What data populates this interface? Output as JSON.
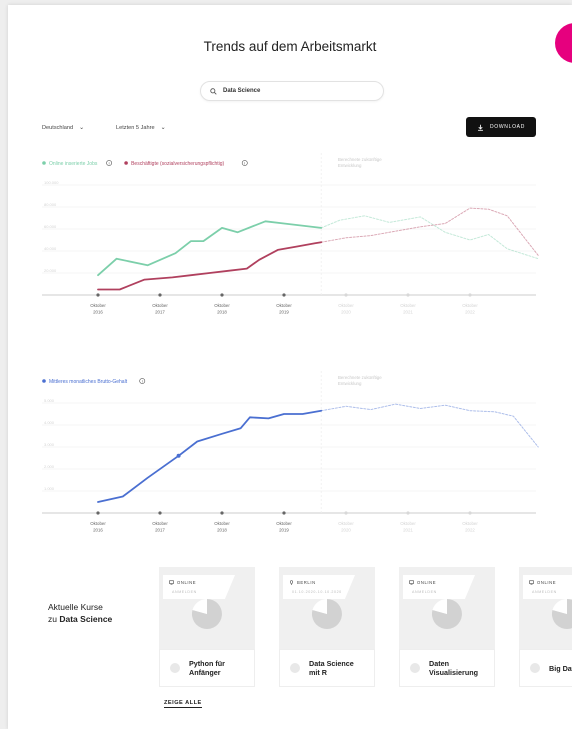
{
  "page": {
    "title": "Trends auf dem Arbeitsmarkt",
    "search_value": "Data Science",
    "region_dropdown": "Deutschland",
    "period_dropdown": "Letzten 5 Jahre",
    "download_label": "DOWNLOAD"
  },
  "colors": {
    "jobs": "#7ccfaa",
    "employed": "#b0405e",
    "salary": "#4a6fd1",
    "accent": "#e6007e"
  },
  "chart_data": [
    {
      "type": "line",
      "legend": [
        "Online inserierte Jobs",
        "Beschäftigte (sozialversicherungspflichtig)"
      ],
      "forecast_label": [
        "Berechnete zukünftige",
        "Entwicklung"
      ],
      "x_ticks": [
        [
          "Oktober",
          "2016"
        ],
        [
          "Oktober",
          "2017"
        ],
        [
          "Oktober",
          "2018"
        ],
        [
          "Oktober",
          "2019"
        ],
        [
          "Oktober",
          "2020"
        ],
        [
          "Oktober",
          "2021"
        ],
        [
          "Oktober",
          "2022"
        ]
      ],
      "y_ticks": [
        "20.000",
        "40.000",
        "60.000",
        "80.000",
        "100.000"
      ],
      "ylim": [
        0,
        100000
      ],
      "grid": true,
      "series": [
        {
          "name": "Online inserierte Jobs",
          "x": [
            0,
            0.3,
            0.8,
            1.25,
            1.5,
            1.7,
            2.0,
            2.25,
            2.7,
            3.0,
            3.6
          ],
          "y": [
            18000,
            33000,
            27000,
            38000,
            49000,
            49000,
            61000,
            57000,
            67000,
            65000,
            61000
          ]
        },
        {
          "name": "Online inserierte Jobs (Prognose)",
          "forecast": true,
          "x": [
            3.6,
            3.9,
            4.3,
            4.7,
            5.2,
            5.6,
            6.0,
            6.3,
            6.6,
            7.1
          ],
          "y": [
            61000,
            68000,
            72000,
            66000,
            71000,
            57000,
            50000,
            55000,
            42000,
            33000
          ]
        },
        {
          "name": "Beschäftigte (sozialversicherungspflichtig)",
          "x": [
            0,
            0.35,
            0.75,
            1.2,
            1.5,
            1.8,
            2.1,
            2.4,
            2.6,
            2.9,
            3.2,
            3.5,
            3.6
          ],
          "y": [
            5000,
            5000,
            14000,
            16000,
            18000,
            20000,
            22000,
            24000,
            32000,
            41000,
            44000,
            47000,
            48000
          ]
        },
        {
          "name": "Beschäftigte (Prognose)",
          "forecast": true,
          "x": [
            3.6,
            4.0,
            4.4,
            4.8,
            5.2,
            5.6,
            6.0,
            6.3,
            6.6,
            7.1
          ],
          "y": [
            48000,
            52000,
            54000,
            58000,
            62000,
            65000,
            79000,
            78000,
            72000,
            36000
          ]
        }
      ]
    },
    {
      "type": "line",
      "legend": [
        "Mittleres monatliches Brutto-Gehalt"
      ],
      "forecast_label": [
        "Berechnete zukünftige",
        "Entwicklung"
      ],
      "x_ticks": [
        [
          "Oktober",
          "2016"
        ],
        [
          "Oktober",
          "2017"
        ],
        [
          "Oktober",
          "2018"
        ],
        [
          "Oktober",
          "2019"
        ],
        [
          "Oktober",
          "2020"
        ],
        [
          "Oktober",
          "2021"
        ],
        [
          "Oktober",
          "2022"
        ]
      ],
      "y_ticks": [
        "1.000",
        "2.000",
        "3.000",
        "4.000",
        "5.000"
      ],
      "ylim": [
        0,
        5000
      ],
      "grid": true,
      "series": [
        {
          "name": "Mittleres monatliches Brutto-Gehalt",
          "x": [
            0,
            0.4,
            0.8,
            1.3,
            1.6,
            2.0,
            2.3,
            2.45,
            2.75,
            3.0,
            3.3,
            3.6
          ],
          "y": [
            500,
            750,
            1600,
            2600,
            3250,
            3600,
            3850,
            4350,
            4300,
            4500,
            4500,
            4650
          ]
        },
        {
          "name": "Gehalt (Prognose)",
          "forecast": true,
          "x": [
            3.6,
            4.0,
            4.4,
            4.8,
            5.2,
            5.6,
            6.0,
            6.4,
            6.7,
            7.1
          ],
          "y": [
            4650,
            4850,
            4700,
            4950,
            4750,
            4900,
            4650,
            4600,
            4400,
            3000
          ]
        }
      ]
    }
  ],
  "courses": {
    "label_line1": "Aktuelle Kurse",
    "label_prefix": "zu",
    "label_topic": "Data Science",
    "show_all": "ZEIGE ALLE",
    "items": [
      {
        "location": "ONLINE",
        "sub": "ANMELDEN",
        "icon": "monitor-icon",
        "name1": "Python für",
        "name2": "Anfänger"
      },
      {
        "location": "BERLIN",
        "sub": "01.10.2020-10.10.2020",
        "icon": "pin-icon",
        "name1": "Data Science",
        "name2": "mit R"
      },
      {
        "location": "ONLINE",
        "sub": "ANMELDEN",
        "icon": "monitor-icon",
        "name1": "Daten",
        "name2": "Visualisierung"
      },
      {
        "location": "ONLINE",
        "sub": "ANMELDEN",
        "icon": "monitor-icon",
        "name1": "Big Data",
        "name2": ""
      }
    ]
  }
}
